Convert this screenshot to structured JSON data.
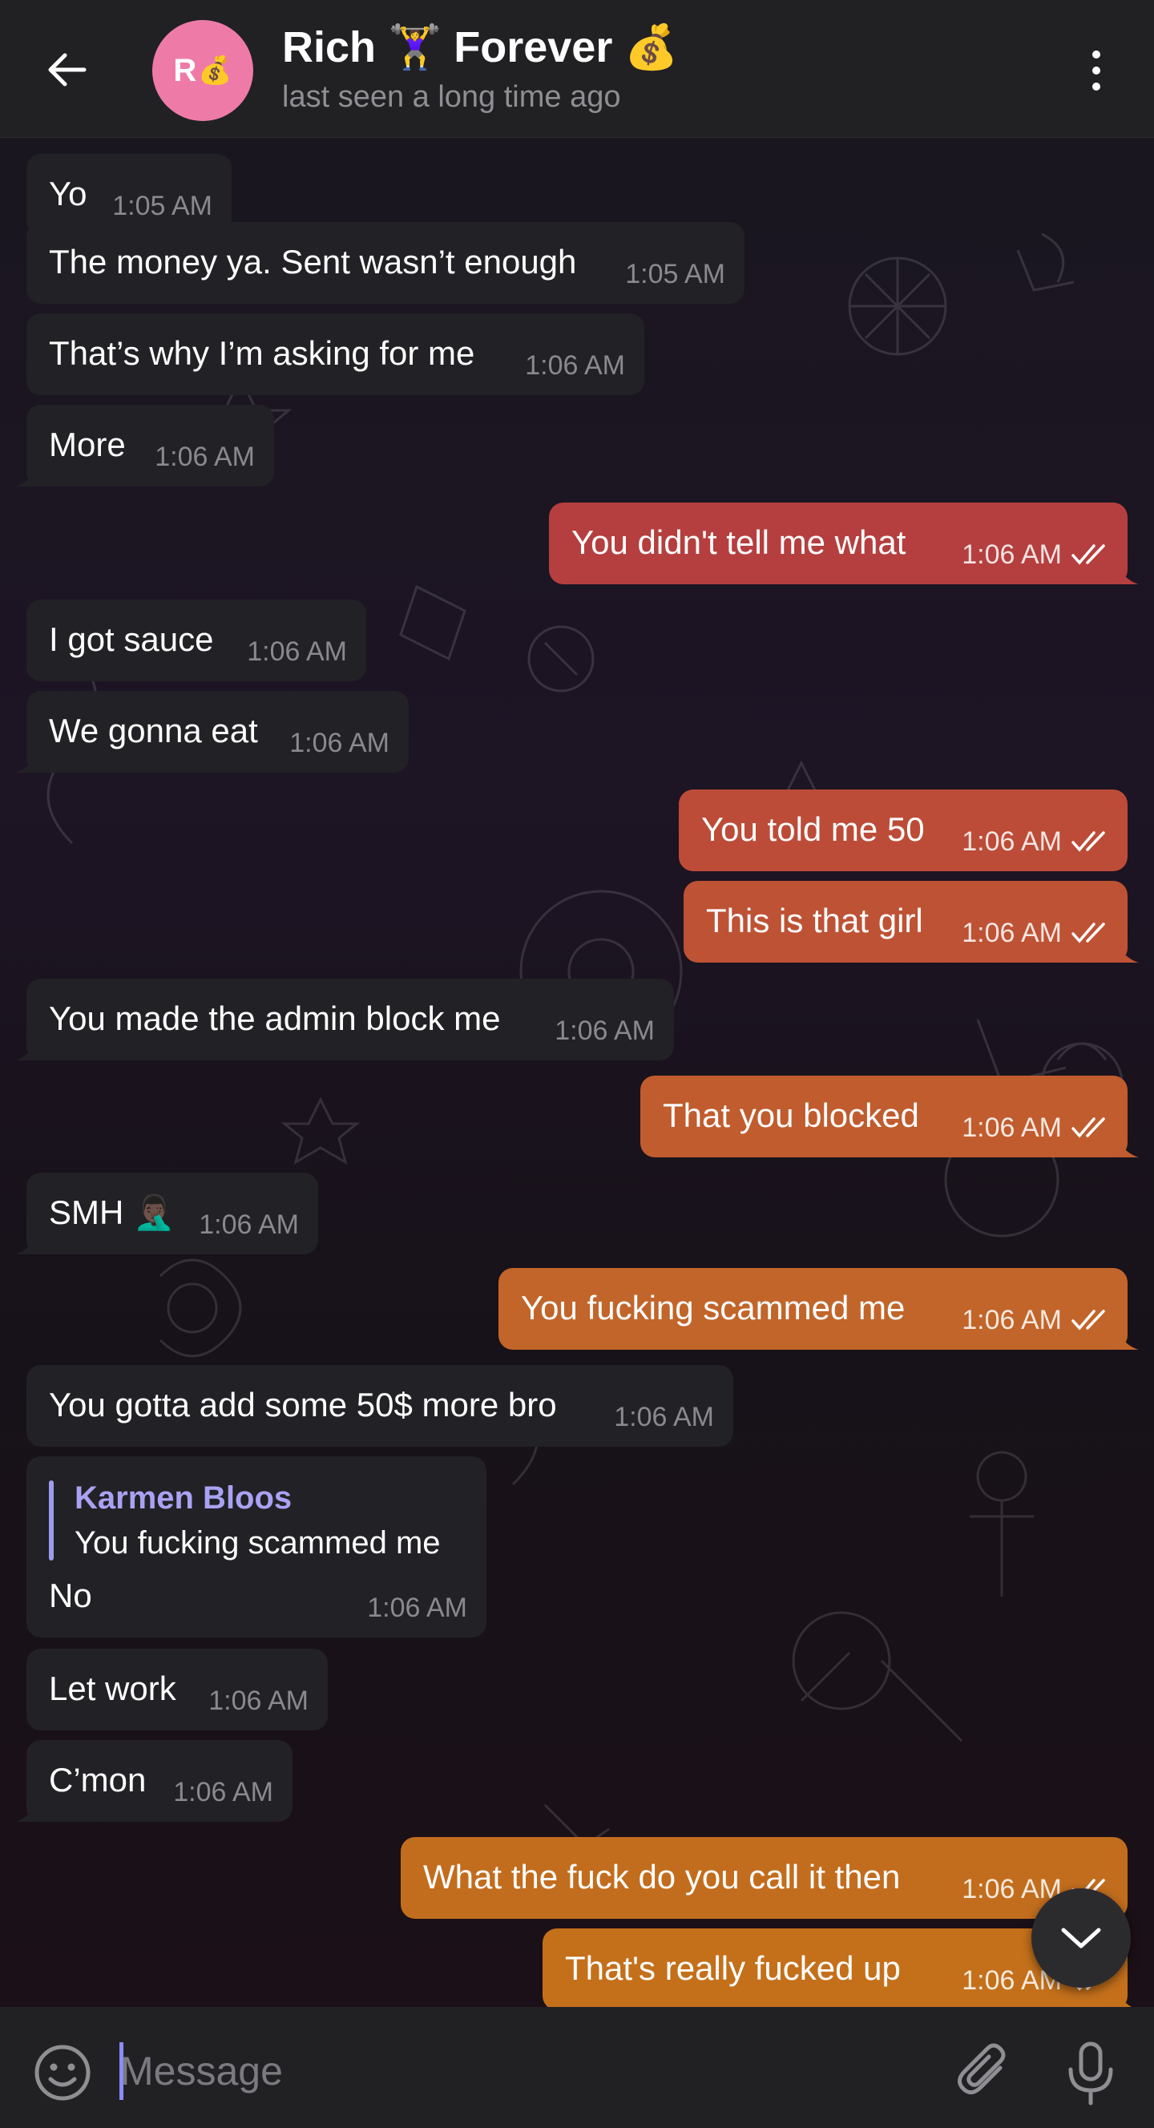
{
  "header": {
    "title": "Rich 🏋️‍♀️ Forever 💰",
    "status": "last seen a long time ago",
    "avatar_letter": "R",
    "avatar_emoji": "💰",
    "avatar_color": "#ee7ba7"
  },
  "colors": {
    "incoming_bubble": "#222125",
    "outgoing_gradient_top": "#b8403f",
    "outgoing_gradient_bottom": "#c46e1a",
    "reply_accent": "#9e9bef"
  },
  "messages": [
    {
      "text": "Yo",
      "time": "1:05 AM",
      "direction": "in"
    },
    {
      "text": "The money ya. Sent wasn’t enough",
      "time": "1:05 AM",
      "direction": "in"
    },
    {
      "text": "That’s why I’m asking for me",
      "time": "1:06 AM",
      "direction": "in"
    },
    {
      "text": "More",
      "time": "1:06 AM",
      "direction": "in"
    },
    {
      "text": "You didn't tell me what",
      "time": "1:06 AM",
      "direction": "out"
    },
    {
      "text": "I got sauce",
      "time": "1:06 AM",
      "direction": "in"
    },
    {
      "text": "We gonna eat",
      "time": "1:06 AM",
      "direction": "in"
    },
    {
      "text": "You told me 50",
      "time": "1:06 AM",
      "direction": "out"
    },
    {
      "text": "This is that girl",
      "time": "1:06 AM",
      "direction": "out"
    },
    {
      "text": "You made the admin block me",
      "time": "1:06 AM",
      "direction": "in"
    },
    {
      "text": "That you blocked",
      "time": "1:06 AM",
      "direction": "out"
    },
    {
      "text": "SMH 🤦🏿‍♂️",
      "time": "1:06 AM",
      "direction": "in"
    },
    {
      "text": "You fucking scammed me",
      "time": "1:06 AM",
      "direction": "out"
    },
    {
      "text": "You gotta add some 50$ more bro",
      "time": "1:06 AM",
      "direction": "in"
    },
    {
      "text": "No",
      "time": "1:06 AM",
      "direction": "in",
      "reply_to": {
        "name": "Karmen Bloos",
        "text": "You fucking scammed me"
      }
    },
    {
      "text": "Let work",
      "time": "1:06 AM",
      "direction": "in"
    },
    {
      "text": "C’mon",
      "time": "1:06 AM",
      "direction": "in"
    },
    {
      "text": "What the fuck do you call it then",
      "time": "1:06 AM",
      "direction": "out"
    },
    {
      "text": "That's really fucked up",
      "time": "1:06 AM",
      "direction": "out"
    }
  ],
  "composer": {
    "placeholder": "Message"
  },
  "icons": {
    "back": "arrow-left-icon",
    "more": "more-vertical-icon",
    "emoji": "smile-icon",
    "attach": "paperclip-icon",
    "mic": "microphone-icon",
    "scroll_down": "chevron-down-icon",
    "read_receipt": "double-check-icon"
  }
}
